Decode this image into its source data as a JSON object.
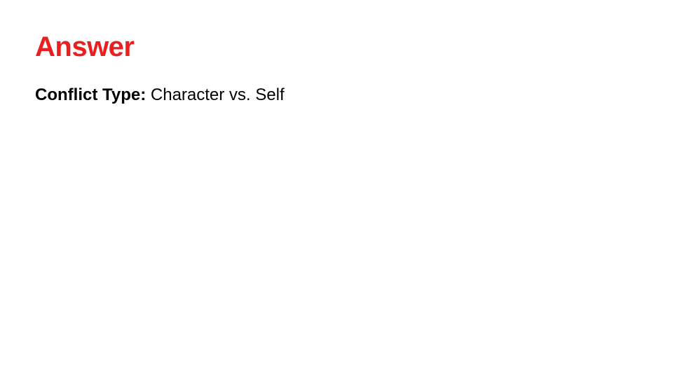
{
  "title": "Answer",
  "line": {
    "label": "Conflict Type: ",
    "value": "Character vs. Self"
  }
}
